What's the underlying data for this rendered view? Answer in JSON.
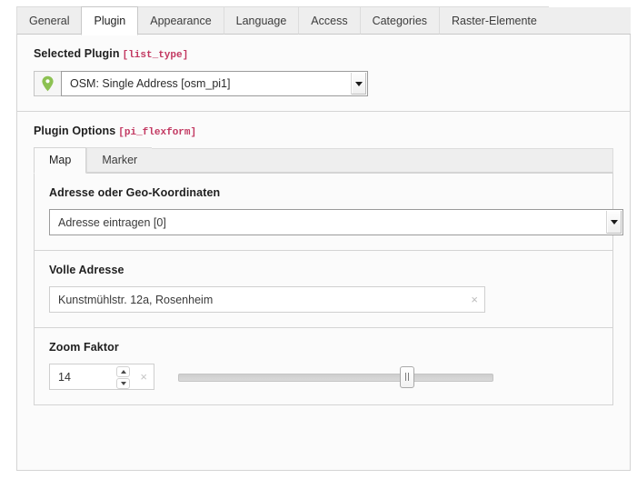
{
  "tabs": [
    {
      "label": "General",
      "active": false
    },
    {
      "label": "Plugin",
      "active": true
    },
    {
      "label": "Appearance",
      "active": false
    },
    {
      "label": "Language",
      "active": false
    },
    {
      "label": "Access",
      "active": false
    },
    {
      "label": "Categories",
      "active": false
    },
    {
      "label": "Raster-Elemente",
      "active": false
    }
  ],
  "selected_plugin": {
    "label": "Selected Plugin",
    "code": "[list_type]",
    "icon": "map-pin-icon",
    "value": "OSM: Single Address [osm_pi1]",
    "arrow": "chevron-down-icon"
  },
  "plugin_options": {
    "label": "Plugin Options",
    "code": "[pi_flexform]",
    "tabs": [
      {
        "label": "Map",
        "active": true
      },
      {
        "label": "Marker",
        "active": false
      }
    ],
    "fields": {
      "address_mode": {
        "label": "Adresse oder Geo-Koordinaten",
        "value": "Adresse eintragen [0]",
        "arrow": "chevron-down-icon"
      },
      "full_address": {
        "label": "Volle Adresse",
        "value": "Kunstmühlstr. 12a, Rosenheim",
        "placeholder": "",
        "clear": "×"
      },
      "zoom_factor": {
        "label": "Zoom Faktor",
        "value": "14",
        "clear": "×",
        "spin_up": "chevron-up-icon",
        "spin_down": "chevron-down-icon",
        "slider_min": 0,
        "slider_max": 19,
        "slider_value": 14
      }
    }
  },
  "colors": {
    "accent_code": "#c23861",
    "pin_green": "#8cc152",
    "panel_bg": "#fbfbfb",
    "tab_inactive": "#eeeeee",
    "border": "#d4d4d4"
  }
}
